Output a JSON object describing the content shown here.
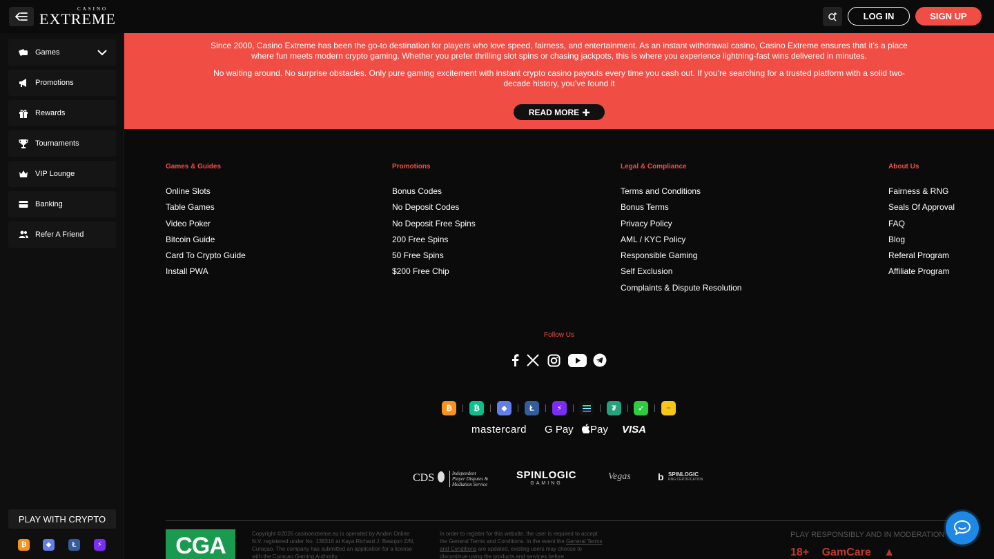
{
  "header": {
    "logo_small": "CASINO",
    "logo_big": "EXTREME",
    "login_label": "LOG IN",
    "signup_label": "SIGN UP"
  },
  "sidebar": {
    "items": [
      {
        "label": "Games",
        "icon": "games-icon"
      },
      {
        "label": "Promotions",
        "icon": "megaphone-icon"
      },
      {
        "label": "Rewards",
        "icon": "gift-icon"
      },
      {
        "label": "Tournaments",
        "icon": "trophy-icon"
      },
      {
        "label": "VIP Lounge",
        "icon": "crown-icon"
      },
      {
        "label": "Banking",
        "icon": "card-icon"
      },
      {
        "label": "Refer A Friend",
        "icon": "users-icon"
      }
    ],
    "play_crypto": "PLAY WITH CRYPTO"
  },
  "banner": {
    "p1": "Since 2000, Casino Extreme has been the go-to destination for players who love speed, fairness, and entertainment. As an instant withdrawal casino, Casino Extreme ensures that it’s a place where fun meets modern crypto gaming. Whether you prefer thrilling slot spins or chasing jackpots, this is where you experience lightning-fast wins delivered in minutes.",
    "p2": "No waiting around. No surprise obstacles. Only pure gaming excitement with instant crypto casino payouts every time you cash out. If you’re searching for a trusted platform with a solid two-decade history, you’ve found it",
    "read_more": "READ MORE"
  },
  "footer": {
    "columns": [
      {
        "title": "Games & Guides",
        "links": [
          "Online Slots",
          "Table Games",
          "Video Poker",
          "Bitcoin Guide",
          "Card To Crypto Guide",
          "Install PWA"
        ]
      },
      {
        "title": "Promotions",
        "links": [
          "Bonus Codes",
          "No Deposit Codes",
          "No Deposit Free Spins",
          "200 Free Spins",
          "50 Free Spins",
          "$200 Free Chip"
        ]
      },
      {
        "title": "Legal & Compliance",
        "links": [
          "Terms and Conditions",
          "Bonus Terms",
          "Privacy Policy",
          "AML / KYC Policy",
          "Responsible Gaming",
          "Self Exclusion",
          "Complaints & Dispute Resolution"
        ]
      },
      {
        "title": "About Us",
        "links": [
          "Fairness & RNG",
          "Seals Of Approval",
          "FAQ",
          "Blog",
          "Referal Program",
          "Affiliate Program"
        ]
      }
    ],
    "follow_us": "Follow Us",
    "payments": {
      "mastercard": "mastercard",
      "gpay": "G Pay",
      "applepay": "Pay",
      "visa": "VISA"
    },
    "certs": {
      "cds": "CDS",
      "cds_sub1": "Independent",
      "cds_sub2": "Player Disputes &",
      "cds_sub3": "Mediation Service",
      "spinlogic": "SPINLOGIC",
      "spinlogic_sub": "GAMING",
      "vegas": "Vegas",
      "rng": "SPINLOGIC",
      "rng_sub": "RNG CERTIFICATION"
    },
    "cga": "CGA",
    "legal1": "Copyright ©2026 casinoextreme.eu is operated by Anden Online N.V. registered under No. 138316 at Kaya Richard J. Beaujon Z/N, Curaçao. The company has submitted an application for a license with the Curaçao Gaming Authority.",
    "legal2a": "In order to register for this website, the user is required to accept the General Terms and Conditions. In the event the ",
    "legal2_link": "General Terms and Conditions",
    "legal2b": " are updated, existing users may choose to discontinue using the products and services before",
    "play_responsibly": "PLAY RESPONSIBLY AND IN MODERATION",
    "age": "18+",
    "gamcare": "GamCare"
  },
  "colors": {
    "accent": "#f04e45",
    "chat": "#1e88e5",
    "cga_green": "#1a9a4f"
  }
}
